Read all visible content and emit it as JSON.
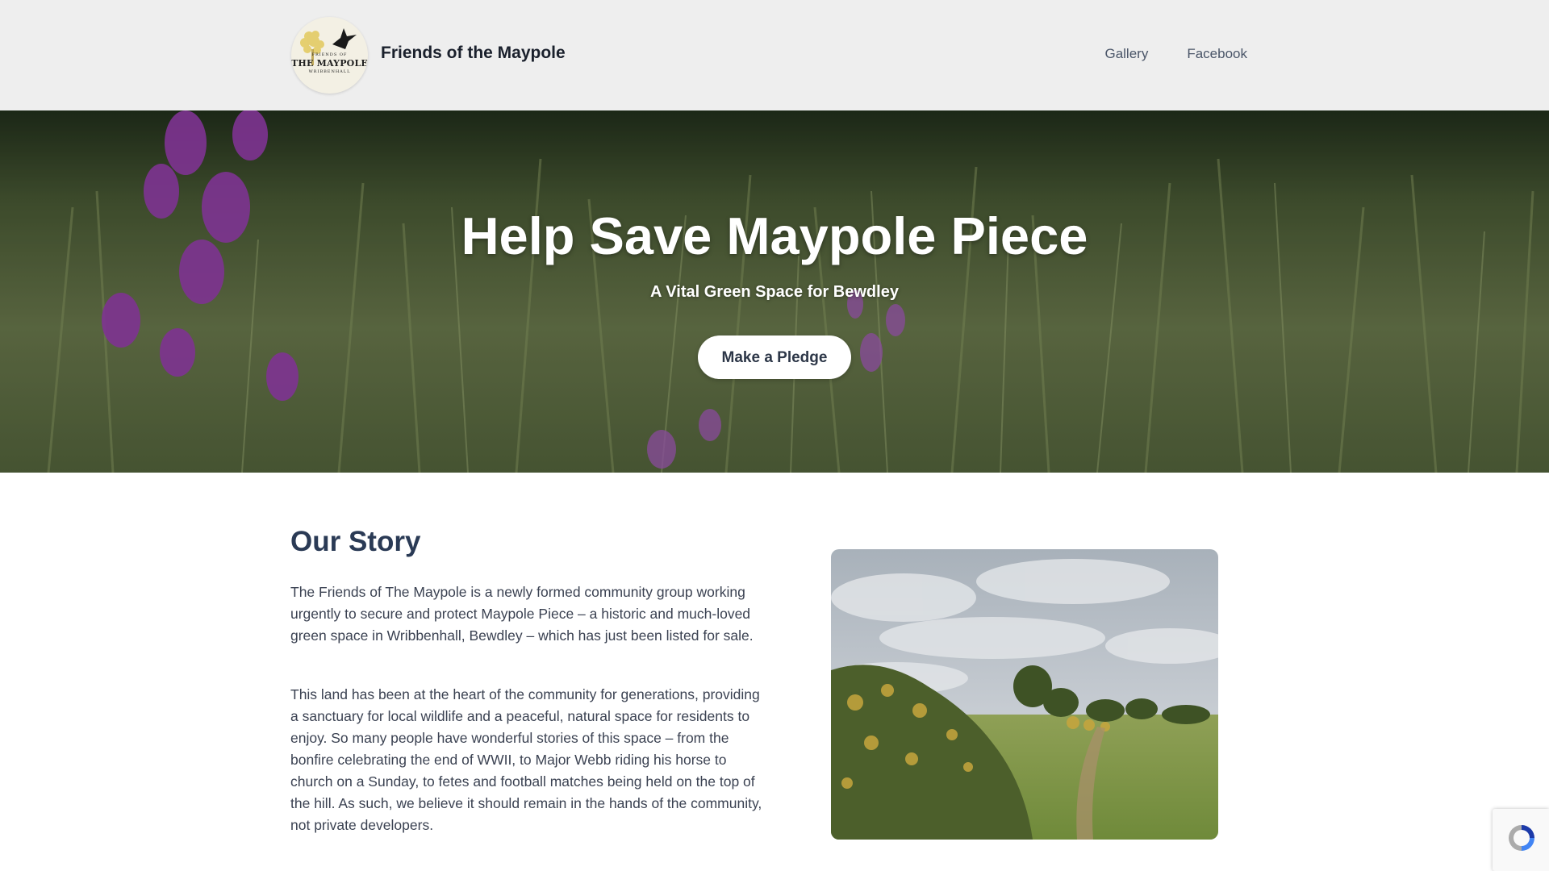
{
  "header": {
    "site_title": "Friends of the Maypole",
    "logo": {
      "line1": "FRIENDS OF",
      "line2": "THE MAYPOLE",
      "line3": "WRIBBENHALL",
      "icon": "bird-and-tree-logo"
    },
    "nav": [
      {
        "label": "Gallery"
      },
      {
        "label": "Facebook"
      }
    ]
  },
  "hero": {
    "title": "Help Save Maypole Piece",
    "subtitle": "A Vital Green Space for Bewdley",
    "cta_label": "Make a Pledge",
    "background": "foxgloves-in-meadow-photo"
  },
  "story": {
    "heading": "Our Story",
    "paragraphs": [
      "The Friends of The Maypole is a newly formed community group working urgently to secure and protect Maypole Piece – a historic and much-loved green space in Wribbenhall, Bewdley – which has just been listed for sale.",
      "This land has been at the heart of the community for generations, providing a sanctuary for local wildlife and a peaceful, natural space for residents to enjoy. So many people have wonderful stories of this space – from the bonfire celebrating the end of WWII, to Major Webb riding his horse to church on a Sunday, to fetes and football matches being held on the top of the hill. As such, we believe it should remain in the hands of the community, not private developers."
    ],
    "photo": "meadow-path-with-gorse-photo"
  },
  "recaptcha": {
    "icon": "recaptcha-icon"
  },
  "colors": {
    "header_bg": "#eeeeee",
    "heading": "#2a3a55",
    "body_text": "#3b4252",
    "button_bg": "#ffffff"
  }
}
